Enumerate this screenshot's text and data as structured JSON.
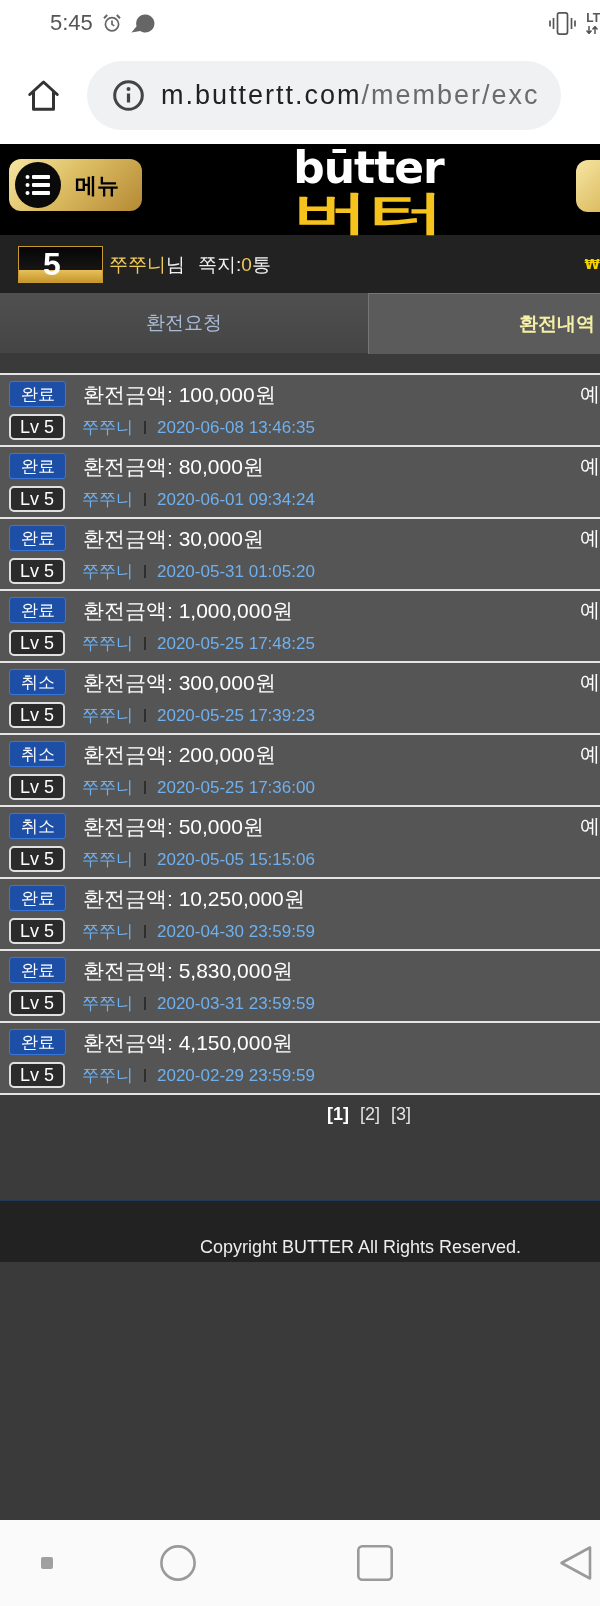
{
  "status_bar": {
    "time": "5:45",
    "network": "LT"
  },
  "browser": {
    "url_host": "m.buttertt.com",
    "url_path": "/member/exc"
  },
  "header": {
    "menu_button": "메뉴",
    "logo_top": "būtter",
    "logo_bottom": "버터"
  },
  "user_bar": {
    "level": "5",
    "user_name": "쭈쭈니",
    "honorific": "님",
    "message_label": "쪽지:",
    "message_count": "0",
    "message_unit": "통",
    "currency": "₩"
  },
  "tabs": [
    {
      "label": "환전요청",
      "selected": false
    },
    {
      "label": "환전내역",
      "selected": true
    }
  ],
  "records": [
    {
      "status": "완료",
      "amount": "환전금액: 100,000원",
      "level": "Lv 5",
      "user": "쭈쭈니",
      "time": "2020-06-08 13:46:35",
      "column_3": "예"
    },
    {
      "status": "완료",
      "amount": "환전금액: 80,000원",
      "level": "Lv 5",
      "user": "쭈쭈니",
      "time": "2020-06-01 09:34:24",
      "column_3": "예"
    },
    {
      "status": "완료",
      "amount": "환전금액: 30,000원",
      "level": "Lv 5",
      "user": "쭈쭈니",
      "time": "2020-05-31 01:05:20",
      "column_3": "예"
    },
    {
      "status": "완료",
      "amount": "환전금액: 1,000,000원",
      "level": "Lv 5",
      "user": "쭈쭈니",
      "time": "2020-05-25 17:48:25",
      "column_3": "예"
    },
    {
      "status": "취소",
      "amount": "환전금액: 300,000원",
      "level": "Lv 5",
      "user": "쭈쭈니",
      "time": "2020-05-25 17:39:23",
      "column_3": "예"
    },
    {
      "status": "취소",
      "amount": "환전금액: 200,000원",
      "level": "Lv 5",
      "user": "쭈쭈니",
      "time": "2020-05-25 17:36:00",
      "column_3": "예"
    },
    {
      "status": "취소",
      "amount": "환전금액: 50,000원",
      "level": "Lv 5",
      "user": "쭈쭈니",
      "time": "2020-05-05 15:15:06",
      "column_3": "예"
    },
    {
      "status": "완료",
      "amount": "환전금액: 10,250,000원",
      "level": "Lv 5",
      "user": "쭈쭈니",
      "time": "2020-04-30 23:59:59"
    },
    {
      "status": "완료",
      "amount": "환전금액: 5,830,000원",
      "level": "Lv 5",
      "user": "쭈쭈니",
      "time": "2020-03-31 23:59:59"
    },
    {
      "status": "완료",
      "amount": "환전금액: 4,150,000원",
      "level": "Lv 5",
      "user": "쭈쭈니",
      "time": "2020-02-29 23:59:59"
    }
  ],
  "pagination": [
    {
      "label": "[1]",
      "selected": true
    },
    {
      "label": "[2]",
      "selected": false
    },
    {
      "label": "[3]",
      "selected": false
    }
  ],
  "footer": {
    "copyright": "Copyright BUTTER All Rights Reserved."
  }
}
